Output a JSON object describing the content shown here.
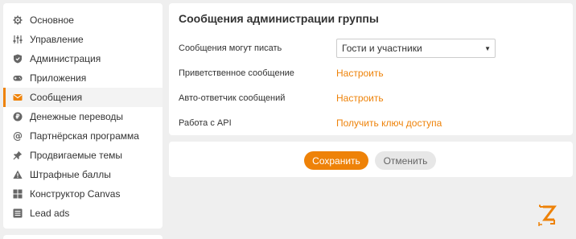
{
  "sidebar": {
    "items": [
      {
        "label": "Основное",
        "icon": "gear-icon"
      },
      {
        "label": "Управление",
        "icon": "sliders-icon"
      },
      {
        "label": "Администрация",
        "icon": "shield-icon"
      },
      {
        "label": "Приложения",
        "icon": "gamepad-icon"
      },
      {
        "label": "Сообщения",
        "icon": "envelope-icon",
        "active": true
      },
      {
        "label": "Денежные переводы",
        "icon": "coin-icon"
      },
      {
        "label": "Партнёрская программа",
        "icon": "at-icon"
      },
      {
        "label": "Продвигаемые темы",
        "icon": "pin-icon"
      },
      {
        "label": "Штрафные баллы",
        "icon": "warning-icon"
      },
      {
        "label": "Конструктор Canvas",
        "icon": "grid-icon"
      },
      {
        "label": "Lead ads",
        "icon": "list-icon"
      }
    ]
  },
  "panel": {
    "title": "Сообщения администрации группы",
    "rows": [
      {
        "label": "Сообщения могут писать",
        "select_value": "Гости и участники"
      },
      {
        "label": "Приветственное сообщение",
        "link": "Настроить"
      },
      {
        "label": "Авто-ответчик сообщений",
        "link": "Настроить"
      },
      {
        "label": "Работа с API",
        "link": "Получить ключ доступа"
      }
    ]
  },
  "actions": {
    "save_label": "Сохранить",
    "cancel_label": "Отменить"
  },
  "colors": {
    "accent": "#ee8208",
    "background": "#efefef"
  }
}
